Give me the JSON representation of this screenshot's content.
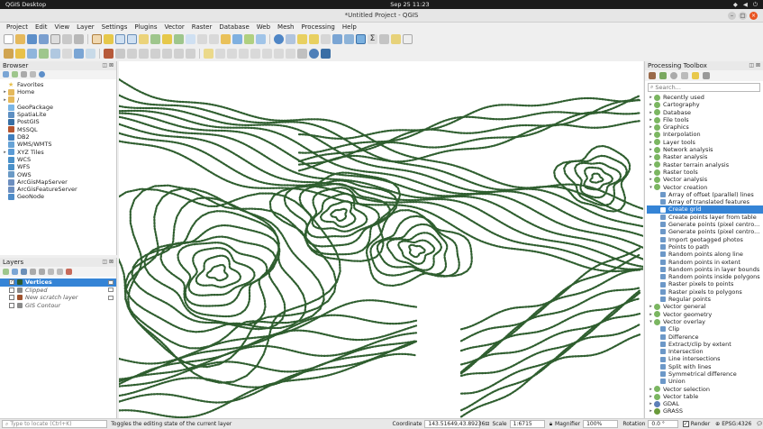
{
  "system": {
    "app_name": "QGIS Desktop",
    "clock": "Sep 25  11:23"
  },
  "window": {
    "title": "*Untitled Project - QGIS"
  },
  "menu": [
    "Project",
    "Edit",
    "View",
    "Layer",
    "Settings",
    "Plugins",
    "Vector",
    "Raster",
    "Database",
    "Web",
    "Mesh",
    "Processing",
    "Help"
  ],
  "browser": {
    "title": "Browser",
    "items": [
      {
        "label": "Favorites",
        "icon": "star-icon",
        "color": "#e8c04a",
        "arrow": ""
      },
      {
        "label": "Home",
        "icon": "folder-icon",
        "color": "#e5b95c",
        "arrow": "▸"
      },
      {
        "label": "/",
        "icon": "folder-icon",
        "color": "#e5b95c",
        "arrow": "▸"
      },
      {
        "label": "GeoPackage",
        "icon": "geopackage-icon",
        "color": "#7bb6e6",
        "arrow": ""
      },
      {
        "label": "SpatiaLite",
        "icon": "spatialite-icon",
        "color": "#5e8fc2",
        "arrow": ""
      },
      {
        "label": "PostGIS",
        "icon": "postgis-icon",
        "color": "#386fa4",
        "arrow": ""
      },
      {
        "label": "MSSQL",
        "icon": "mssql-icon",
        "color": "#b5552f",
        "arrow": ""
      },
      {
        "label": "DB2",
        "icon": "db2-icon",
        "color": "#3f7fbf",
        "arrow": ""
      },
      {
        "label": "WMS/WMTS",
        "icon": "wms-icon",
        "color": "#67a3d6",
        "arrow": ""
      },
      {
        "label": "XYZ Tiles",
        "icon": "xyz-tiles-icon",
        "color": "#5b9bd5",
        "arrow": "▸"
      },
      {
        "label": "WCS",
        "icon": "wcs-icon",
        "color": "#4a90c9",
        "arrow": ""
      },
      {
        "label": "WFS",
        "icon": "wfs-icon",
        "color": "#4a90c9",
        "arrow": ""
      },
      {
        "label": "OWS",
        "icon": "ows-icon",
        "color": "#6a9ac6",
        "arrow": ""
      },
      {
        "label": "ArcGisMapServer",
        "icon": "arcgis-mapserver-icon",
        "color": "#6c8ebf",
        "arrow": ""
      },
      {
        "label": "ArcGisFeatureServer",
        "icon": "arcgis-featureserver-icon",
        "color": "#6c8ebf",
        "arrow": ""
      },
      {
        "label": "GeoNode",
        "icon": "geonode-icon",
        "color": "#4f8cc8",
        "arrow": ""
      }
    ]
  },
  "layers": {
    "title": "Layers",
    "items": [
      {
        "label": "Vertices",
        "checked": true,
        "selected": true,
        "italic": false,
        "color": "#2d5a2d"
      },
      {
        "label": "Clipped",
        "checked": false,
        "selected": false,
        "italic": true,
        "color": "#8a8a8a"
      },
      {
        "label": "New scratch layer",
        "checked": false,
        "selected": false,
        "italic": true,
        "color": "#a0522d"
      },
      {
        "label": "GIS Contour",
        "checked": false,
        "selected": false,
        "italic": true,
        "color": "#8a8a8a"
      }
    ]
  },
  "toolbox": {
    "title": "Processing Toolbox",
    "search_placeholder": "Search...",
    "items": [
      {
        "label": "Recently used",
        "level": 0,
        "arrow": "▸",
        "selected": false
      },
      {
        "label": "Cartography",
        "level": 0,
        "arrow": "▸",
        "selected": false
      },
      {
        "label": "Database",
        "level": 0,
        "arrow": "▸",
        "selected": false
      },
      {
        "label": "File tools",
        "level": 0,
        "arrow": "▸",
        "selected": false
      },
      {
        "label": "Graphics",
        "level": 0,
        "arrow": "▸",
        "selected": false
      },
      {
        "label": "Interpolation",
        "level": 0,
        "arrow": "▸",
        "selected": false
      },
      {
        "label": "Layer tools",
        "level": 0,
        "arrow": "▸",
        "selected": false
      },
      {
        "label": "Network analysis",
        "level": 0,
        "arrow": "▸",
        "selected": false
      },
      {
        "label": "Raster analysis",
        "level": 0,
        "arrow": "▸",
        "selected": false
      },
      {
        "label": "Raster terrain analysis",
        "level": 0,
        "arrow": "▸",
        "selected": false
      },
      {
        "label": "Raster tools",
        "level": 0,
        "arrow": "▸",
        "selected": false
      },
      {
        "label": "Vector analysis",
        "level": 0,
        "arrow": "▸",
        "selected": false
      },
      {
        "label": "Vector creation",
        "level": 0,
        "arrow": "▾",
        "selected": false
      },
      {
        "label": "Array of offset (parallel) lines",
        "level": 1,
        "arrow": "",
        "selected": false
      },
      {
        "label": "Array of translated features",
        "level": 1,
        "arrow": "",
        "selected": false
      },
      {
        "label": "Create grid",
        "level": 1,
        "arrow": "",
        "selected": true
      },
      {
        "label": "Create points layer from table",
        "level": 1,
        "arrow": "",
        "selected": false
      },
      {
        "label": "Generate points (pixel centro...",
        "level": 1,
        "arrow": "",
        "selected": false
      },
      {
        "label": "Generate points (pixel centro...",
        "level": 1,
        "arrow": "",
        "selected": false
      },
      {
        "label": "Import geotagged photos",
        "level": 1,
        "arrow": "",
        "selected": false
      },
      {
        "label": "Points to path",
        "level": 1,
        "arrow": "",
        "selected": false
      },
      {
        "label": "Random points along line",
        "level": 1,
        "arrow": "",
        "selected": false
      },
      {
        "label": "Random points in extent",
        "level": 1,
        "arrow": "",
        "selected": false
      },
      {
        "label": "Random points in layer bounds",
        "level": 1,
        "arrow": "",
        "selected": false
      },
      {
        "label": "Random points inside polygons",
        "level": 1,
        "arrow": "",
        "selected": false
      },
      {
        "label": "Raster pixels to points",
        "level": 1,
        "arrow": "",
        "selected": false
      },
      {
        "label": "Raster pixels to polygons",
        "level": 1,
        "arrow": "",
        "selected": false
      },
      {
        "label": "Regular points",
        "level": 1,
        "arrow": "",
        "selected": false
      },
      {
        "label": "Vector general",
        "level": 0,
        "arrow": "▸",
        "selected": false
      },
      {
        "label": "Vector geometry",
        "level": 0,
        "arrow": "▸",
        "selected": false
      },
      {
        "label": "Vector overlay",
        "level": 0,
        "arrow": "▾",
        "selected": false
      },
      {
        "label": "Clip",
        "level": 1,
        "arrow": "",
        "selected": false
      },
      {
        "label": "Difference",
        "level": 1,
        "arrow": "",
        "selected": false
      },
      {
        "label": "Extract/clip by extent",
        "level": 1,
        "arrow": "",
        "selected": false
      },
      {
        "label": "Intersection",
        "level": 1,
        "arrow": "",
        "selected": false
      },
      {
        "label": "Line intersections",
        "level": 1,
        "arrow": "",
        "selected": false
      },
      {
        "label": "Split with lines",
        "level": 1,
        "arrow": "",
        "selected": false
      },
      {
        "label": "Symmetrical difference",
        "level": 1,
        "arrow": "",
        "selected": false
      },
      {
        "label": "Union",
        "level": 1,
        "arrow": "",
        "selected": false
      },
      {
        "label": "Vector selection",
        "level": 0,
        "arrow": "▸",
        "selected": false
      },
      {
        "label": "Vector table",
        "level": 0,
        "arrow": "▸",
        "selected": false
      },
      {
        "label": "GDAL",
        "level": 0,
        "arrow": "▸",
        "selected": false
      },
      {
        "label": "GRASS",
        "level": 0,
        "arrow": "▸",
        "selected": false
      }
    ]
  },
  "status": {
    "locator_placeholder": "Type to locate (Ctrl+K)",
    "message": "Toggles the editing state of the current layer",
    "coordinate_label": "Coordinate",
    "coordinate_value": "143.51649,43.89236",
    "scale_label": "Scale",
    "scale_value": "1:6715",
    "magnifier_label": "Magnifier",
    "magnifier_value": "100%",
    "rotation_label": "Rotation",
    "rotation_value": "0.0 °",
    "render_label": "Render",
    "crs_label": "EPSG:4326"
  },
  "colors": {
    "contour": "#2f5e2f",
    "selection": "#3584d6",
    "map_background": "#ffffff"
  }
}
